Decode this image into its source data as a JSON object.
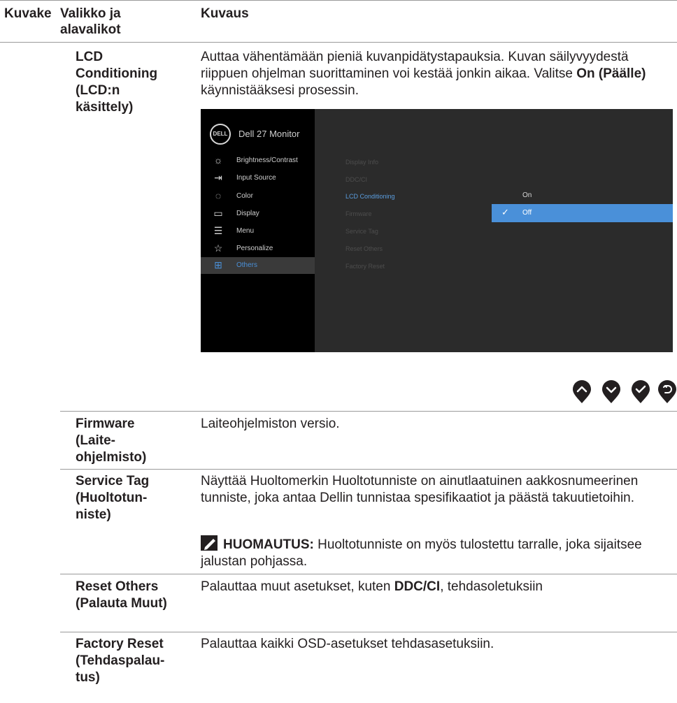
{
  "table": {
    "headers": {
      "icon": "Kuvake",
      "menu": "Valikko ja alavalikot",
      "desc": "Kuvaus"
    },
    "lcd": {
      "name": "LCD Conditioning (LCD:n käsittely)",
      "desc_pre": "Auttaa vähentämään pieniä kuvanpidätystapauksia. Kuvan säilyvyydestä riippuen ohjelman suorittaminen voi kestää jonkin aikaa. Valitse ",
      "desc_bold": "On (Päälle)",
      "desc_post": " käynnistääksesi prosessin."
    },
    "firmware": {
      "name": "Firmware (Laite-ohjelmisto)",
      "desc": "Laiteohjelmiston versio."
    },
    "service_tag": {
      "name": "Service Tag (Huoltotun-niste)",
      "desc": "Näyttää Huoltomerkin Huoltotunniste on ainutlaatuinen aakkosnumeerinen tunniste, joka antaa Dellin tunnistaa spesifikaatiot ja päästä takuutietoihin.",
      "note_label": "HUOMAUTUS:",
      "note_text": " Huoltotunniste on myös tulostettu tarralle, joka sijaitsee jalustan pohjassa."
    },
    "reset_others": {
      "name": "Reset Others (Palauta Muut)",
      "desc_pre": "Palauttaa muut asetukset, kuten ",
      "desc_bold": "DDC/CI",
      "desc_post": ", tehdasoletuksiin"
    },
    "factory_reset": {
      "name": "Factory Reset (Tehdaspalau-tus)",
      "desc": "Palauttaa kaikki OSD-asetukset tehdasasetuksiin."
    }
  },
  "osd": {
    "logo": "DELL",
    "title": "Dell 27 Monitor",
    "menu": [
      "Brightness/Contrast",
      "Input Source",
      "Color",
      "Display",
      "Menu",
      "Personalize",
      "Others"
    ],
    "submenu": [
      "Display Info",
      "DDC/CI",
      "LCD Conditioning",
      "Firmware",
      "Service Tag",
      "Reset Others",
      "Factory Reset"
    ],
    "options": [
      "On",
      "Off"
    ],
    "selected_option": "Off",
    "accent": "#4a90d9"
  },
  "nav_buttons": [
    "up-icon",
    "down-icon",
    "check-icon",
    "back-icon"
  ]
}
